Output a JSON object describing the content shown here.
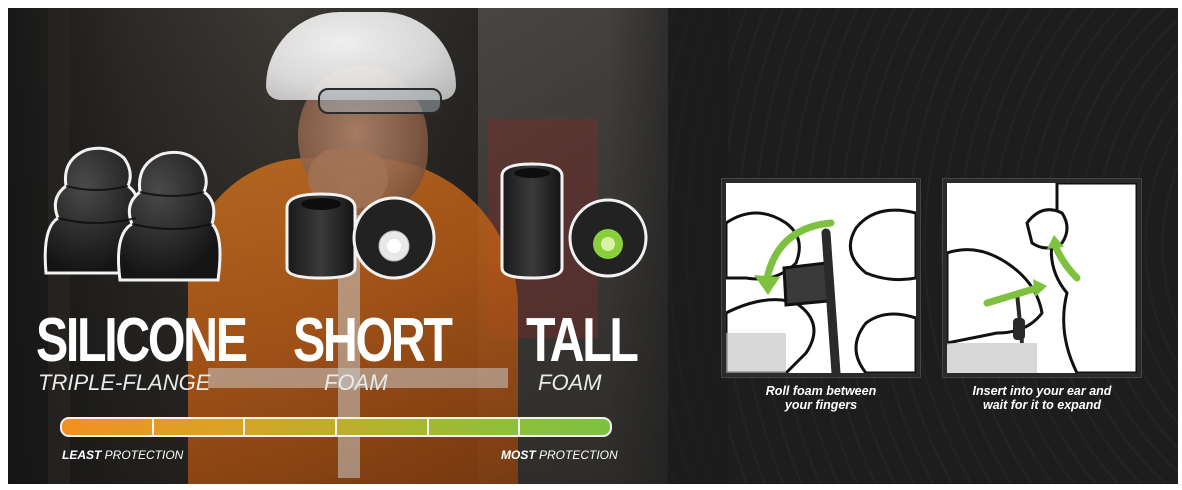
{
  "tips": [
    {
      "name": "SILICONE",
      "sub": "TRIPLE-FLANGE"
    },
    {
      "name": "SHORT",
      "sub": "FOAM"
    },
    {
      "name": "TALL",
      "sub": "FOAM"
    }
  ],
  "protection": {
    "least_strong": "LEAST",
    "least_rest": " PROTECTION",
    "most_strong": "MOST",
    "most_rest": " PROTECTION",
    "segments": 6
  },
  "steps": [
    {
      "caption_line1": "Roll foam between",
      "caption_line2": "your fingers"
    },
    {
      "caption_line1": "Insert into your ear and",
      "caption_line2": "wait for it to expand"
    }
  ],
  "colors": {
    "accent_green": "#7dc13e",
    "accent_orange": "#f3901d",
    "dark_bg": "#1c1c1c"
  }
}
